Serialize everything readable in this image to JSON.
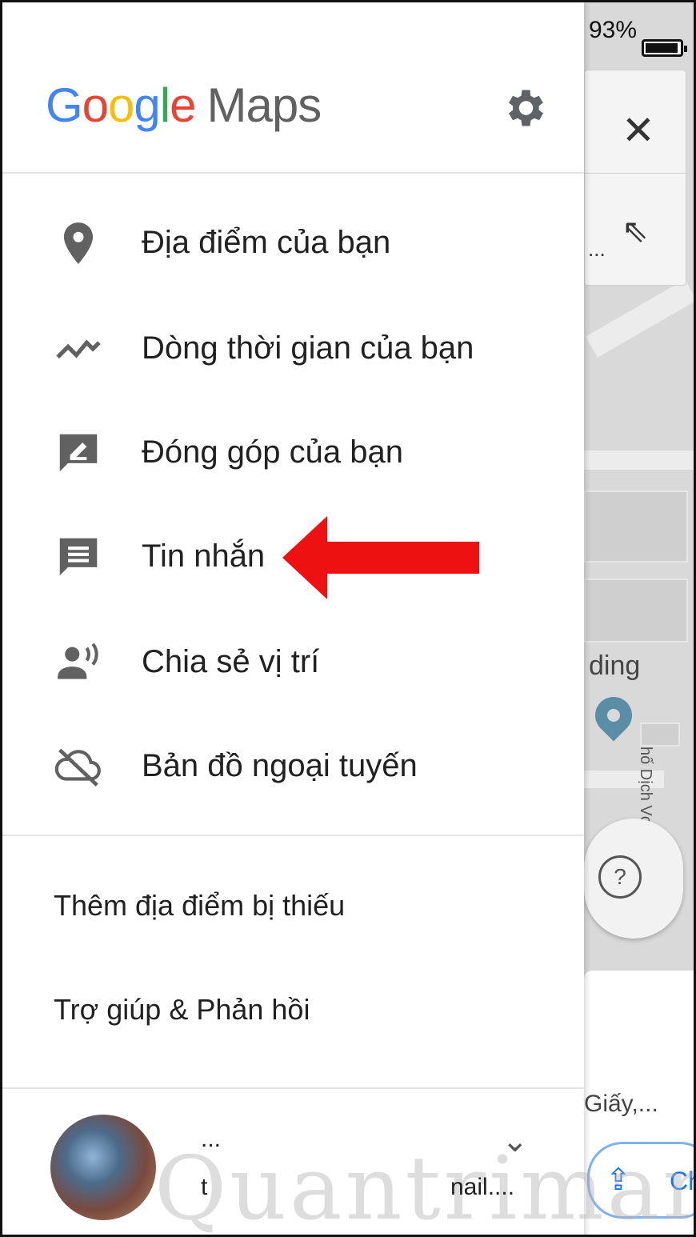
{
  "status_bar": {
    "battery_text": "93%"
  },
  "header": {
    "logo_letters": [
      "G",
      "o",
      "o",
      "g",
      "l",
      "e"
    ],
    "logo_suffix": "Maps",
    "settings_icon": "gear-icon"
  },
  "menu": [
    {
      "label": "Địa điểm của bạn",
      "icon": "location-pin-icon"
    },
    {
      "label": "Dòng thời gian của bạn",
      "icon": "timeline-icon"
    },
    {
      "label": "Đóng góp của bạn",
      "icon": "contributions-icon"
    },
    {
      "label": "Tin nhắn",
      "icon": "messages-icon"
    },
    {
      "label": "Chia sẻ vị trí",
      "icon": "location-sharing-icon"
    },
    {
      "label": "Bản đồ ngoại tuyến",
      "icon": "offline-cloud-icon"
    }
  ],
  "secondary": [
    {
      "label": "Thêm địa điểm bị thiếu"
    },
    {
      "label": "Trợ giúp & Phản hồi"
    }
  ],
  "account": {
    "name": "...",
    "email_prefix": "t",
    "email_suffix": "nail....",
    "watermark": "Quantrimang"
  },
  "map": {
    "poi_label": "ding",
    "street_label": "hố Dịch Vọng Hậu",
    "info_text": "Giấy,...",
    "share_label": "Ch",
    "menu_dots": "..."
  },
  "colors": {
    "google_blue": "#4285f4",
    "google_red": "#ea4335",
    "google_yellow": "#fbbc05",
    "google_green": "#34a853",
    "annotation_arrow": "#ee1111"
  }
}
